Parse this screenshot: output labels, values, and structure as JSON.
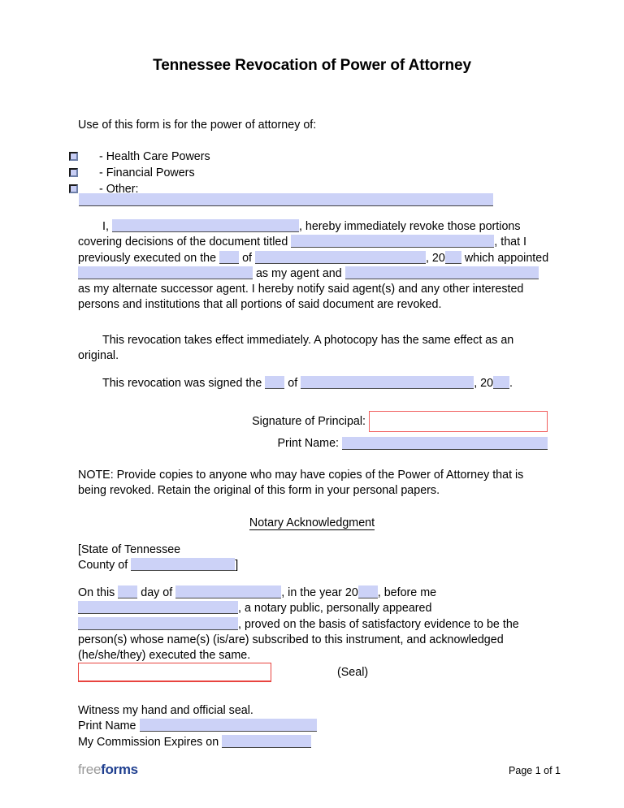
{
  "document": {
    "title": "Tennessee Revocation of Power of Attorney",
    "intro": "Use of this form is for the power of attorney of:"
  },
  "checkboxes": [
    {
      "label": "- Health Care Powers",
      "icon": "checkbox-icon",
      "checked": false
    },
    {
      "label": "- Financial Powers",
      "icon": "checkbox-icon",
      "checked": false
    },
    {
      "label": "- Other:",
      "icon": "checkbox-icon",
      "checked": false
    }
  ],
  "other_field": {
    "value": "",
    "placeholder": ""
  },
  "revocation_paragraph": {
    "t1": "I,",
    "f1": "",
    "t2": ", hereby immediately revoke those portions covering decisions of the document titled",
    "f2": "",
    "t3": ", that I previously executed on the",
    "f3": "",
    "t4": "of",
    "f4": "",
    "t5": ", 20",
    "f5": "",
    "t6": "which appointed",
    "f6": "",
    "t7": "as my agent and",
    "f7": "",
    "t8": "as my alternate successor agent. I hereby notify said agent(s) and any other interested persons and institutions that all portions of said document are revoked."
  },
  "effect_paragraph": "This revocation takes effect immediately. A photocopy has the same effect as an original.",
  "signed_paragraph": {
    "t1": "This revocation was signed the",
    "f1": "",
    "t2": "of",
    "f2": "",
    "t3": ", 20",
    "f3": "",
    "t4": "."
  },
  "signature_block": {
    "principal_label": "Signature of Principal:",
    "principal_value": "",
    "print_name_label": "Print Name:",
    "print_name_value": ""
  },
  "note_paragraph": "NOTE: Provide copies to anyone who may have copies of the Power of Attorney that is being revoked. Retain the original of this form in your personal papers.",
  "notary": {
    "heading": "Notary Acknowledgment",
    "state_line": "[State of Tennessee",
    "county_label": "County of",
    "county_value": "",
    "county_close": "]",
    "ack": {
      "t1": "On this",
      "f1": "",
      "t2": "day of",
      "f2": "",
      "t3": ", in the year 20",
      "f3": "",
      "t4": ", before me",
      "f4": "",
      "t5": ", a notary public, personally appeared",
      "f5": "",
      "t6": ", proved on the basis of satisfactory evidence to be the person(s) whose name(s) (is/are) subscribed to this instrument, and acknowledged (he/she/they) executed the same."
    },
    "seal_signature_value": "",
    "seal_label": "(Seal)",
    "witness_line": "Witness my hand and official seal.",
    "print_name_label": "Print Name",
    "print_name_value": "",
    "commission_label": "My Commission Expires on",
    "commission_value": ""
  },
  "footer": {
    "logo_part1": "free",
    "logo_part2": "forms",
    "page_indicator": "Page 1 of 1"
  },
  "colors": {
    "field_fill": "#ccd2f7",
    "field_underline": "#4a4a4a",
    "signature_border": "#f1605f",
    "seal_border": "#e8443f",
    "logo_free": "#9a9a9a",
    "logo_forms": "#1f3f8f"
  }
}
